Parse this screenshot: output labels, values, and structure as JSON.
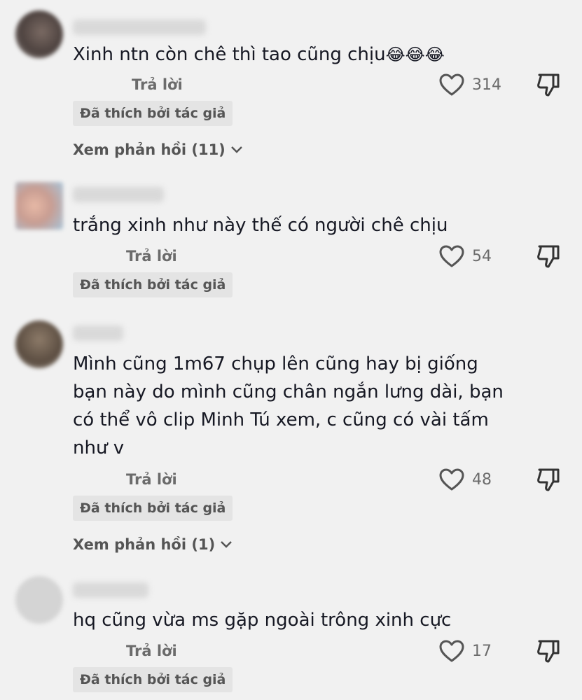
{
  "reply_label": "Trả lời",
  "badge_label": "Đã thích bởi tác giả",
  "comments": [
    {
      "text": "Xinh ntn còn chê thì tao cũng chịu",
      "emoji": "😂😂😂",
      "likes": "314",
      "view_replies": "Xem phản hồi (11)"
    },
    {
      "text": "trắng xinh như này thế có người chê chịu",
      "likes": "54"
    },
    {
      "text": "Mình cũng 1m67 chụp lên cũng hay bị giống bạn này do mình cũng chân ngắn lưng dài, bạn có thể vô clip Minh Tú xem, c cũng có vài tấm như v",
      "likes": "48",
      "view_replies": "Xem phản hồi (1)"
    },
    {
      "text": "hq cũng vừa ms gặp ngoài trông xinh cực",
      "likes": "17"
    }
  ],
  "colors": {
    "background": "#f1f1f1",
    "text": "#161823",
    "muted": "#6b6b6b",
    "badge_bg": "#e4e4e4"
  }
}
